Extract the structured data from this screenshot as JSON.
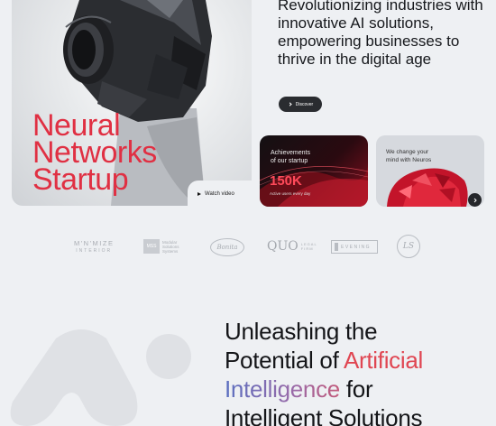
{
  "hero": {
    "title_lines": [
      "Neural",
      "Networks",
      "Startup"
    ],
    "watch_label": "Watch video"
  },
  "tagline": {
    "text": "Revolutionizing industries with innovative AI solutions, empowering businesses to thrive in the digital age",
    "discover_label": "Discover"
  },
  "achievements": {
    "label_line1": "Achievements",
    "label_line2": "of our startup",
    "number": "150K",
    "sub": "Active users every day"
  },
  "neuros": {
    "label_line1": "We change your",
    "label_line2": "mind with Neuros"
  },
  "logos": {
    "minimize_top": "M'N'MIZE",
    "minimize_bottom": "INTERIOR",
    "solutions_box": "MSS",
    "solutions_text": "Modular Solutions Systems",
    "script_logo": "Bonita",
    "quo": "QUO",
    "quo_small": "LEGAL FIRM",
    "evening": "EVENING",
    "circle_logo": "LS"
  },
  "section2": {
    "line1": "Unleashing the",
    "line2_a": "Potential of ",
    "line2_b": "Artificial",
    "line3_a": "Intelligence",
    "line3_b": " for",
    "line4": "Intelligent Solutions"
  },
  "colors": {
    "accent_red": "#e03043",
    "dark": "#16181c",
    "background": "#eef0f3"
  }
}
